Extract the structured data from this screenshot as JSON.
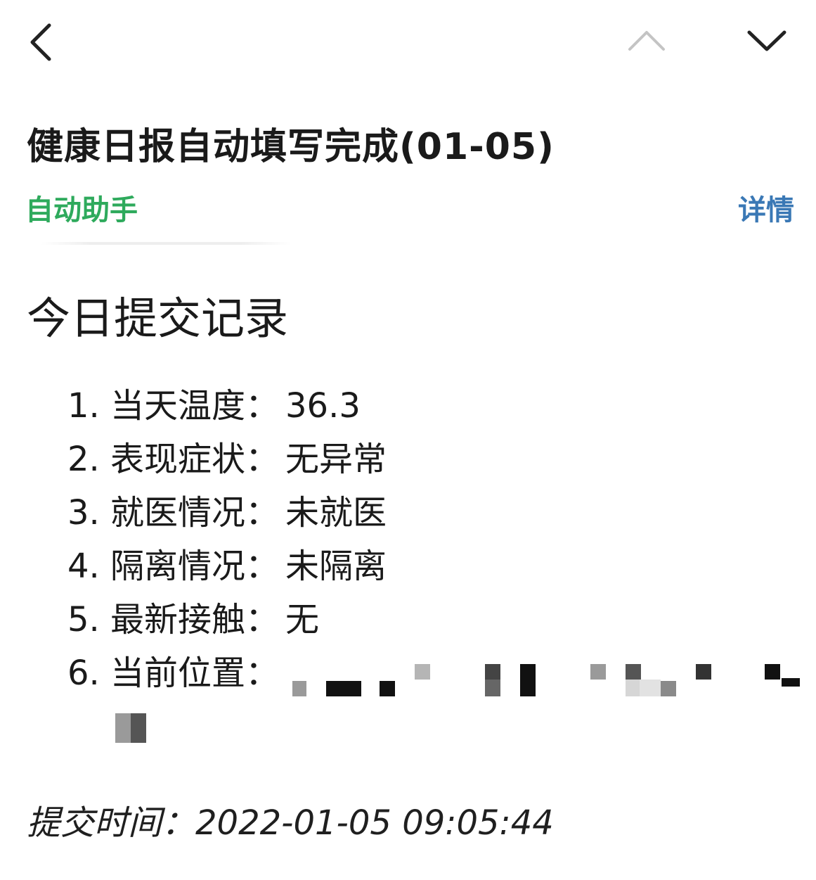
{
  "message": {
    "title": "健康日报自动填写完成(01-05)",
    "sender": "自动助手",
    "detail_link": "详情"
  },
  "content": {
    "heading": "今日提交记录",
    "records": [
      {
        "label": "1. 当天温度：",
        "value": "36.3"
      },
      {
        "label": "2. 表现症状：",
        "value": "无异常"
      },
      {
        "label": "3. 就医情况：",
        "value": "未就医"
      },
      {
        "label": "4. 隔离情况：",
        "value": "未隔离"
      },
      {
        "label": "5. 最新接触：",
        "value": "无"
      },
      {
        "label": "6. 当前位置：",
        "value": ""
      }
    ],
    "submit_time": "提交时间：2022-01-05 09:05:44"
  },
  "icons": {
    "back": "chevron-left-icon",
    "prev": "chevron-up-icon",
    "next": "chevron-down-icon"
  },
  "colors": {
    "sender": "#2eaa5c",
    "detail_link": "#3a78b5",
    "prev_disabled": "#c4c4c4"
  }
}
